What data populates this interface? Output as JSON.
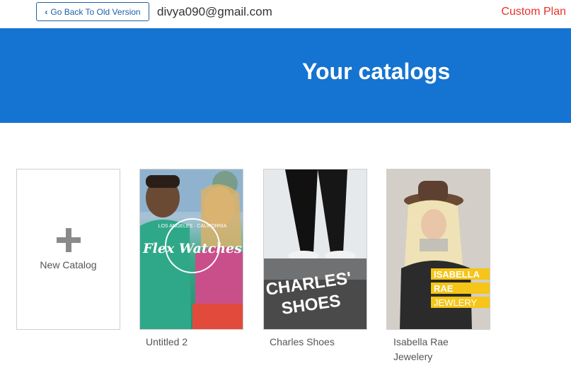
{
  "topbar": {
    "back_label": "Go Back To Old Version",
    "email": "divya090@gmail.com",
    "plan": "Custom Plan"
  },
  "hero": {
    "title": "Your catalogs"
  },
  "new_catalog": {
    "label": "New Catalog"
  },
  "catalogs": [
    {
      "name": "Untitled 2",
      "cover_text": "Flex Watches",
      "cover_small": "LOS ANGELES · CALIFORNIA"
    },
    {
      "name": "Charles Shoes",
      "cover_text_1": "CHARLES'",
      "cover_text_2": "SHOES"
    },
    {
      "name": "Isabella Rae Jewelery",
      "name_line1": "Isabella Rae",
      "name_line2": "Jewelery",
      "cover_band": [
        "ISABELLA",
        "RAE",
        "JEWLERY"
      ]
    }
  ],
  "colors": {
    "accent": "#1573d1",
    "plan": "#e8322b",
    "band": "#f5c518"
  }
}
